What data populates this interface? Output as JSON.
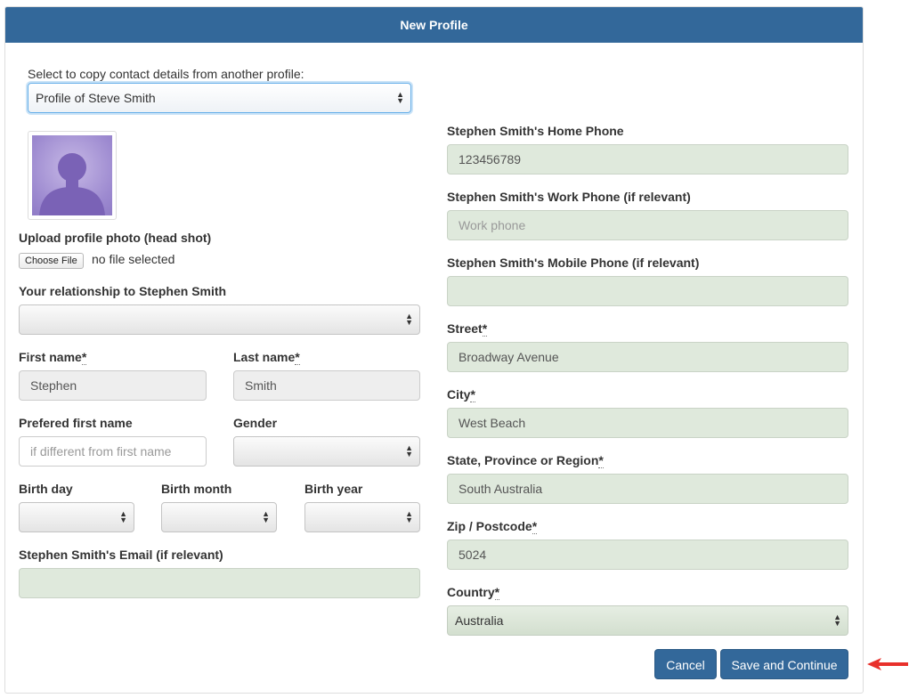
{
  "header": {
    "title": "New Profile"
  },
  "copy": {
    "label": "Select to copy contact details from another profile:",
    "selected": "Profile of Steve Smith"
  },
  "photo": {
    "upload_label": "Upload profile photo (head shot)",
    "choose_file": "Choose File",
    "no_file": "no file selected"
  },
  "relationship": {
    "label": "Your relationship to Stephen Smith",
    "value": ""
  },
  "first_name": {
    "label": "First name",
    "value": "Stephen"
  },
  "last_name": {
    "label": "Last name",
    "value": "Smith"
  },
  "preferred_name": {
    "label": "Prefered first name",
    "placeholder": "if different from first name"
  },
  "gender": {
    "label": "Gender",
    "value": ""
  },
  "birth": {
    "day_label": "Birth day",
    "month_label": "Birth month",
    "year_label": "Birth year"
  },
  "email": {
    "label": "Stephen Smith's Email (if relevant)",
    "value": ""
  },
  "home_phone": {
    "label": "Stephen Smith's Home Phone",
    "value": "123456789"
  },
  "work_phone": {
    "label": "Stephen Smith's Work Phone (if relevant)",
    "placeholder": "Work phone"
  },
  "mobile_phone": {
    "label": "Stephen Smith's Mobile Phone (if relevant)",
    "value": ""
  },
  "street": {
    "label": "Street",
    "value": "Broadway Avenue"
  },
  "city": {
    "label": "City",
    "value": "West Beach"
  },
  "state": {
    "label": "State, Province or Region",
    "value": "South Australia"
  },
  "zip": {
    "label": "Zip / Postcode",
    "value": "5024"
  },
  "country": {
    "label": "Country",
    "value": "Australia"
  },
  "required_marker": "*",
  "actions": {
    "cancel": "Cancel",
    "save": "Save and Continue"
  },
  "colors": {
    "header": "#33689a",
    "field_green": "#dfe9dc",
    "arrow": "#e8302b"
  }
}
